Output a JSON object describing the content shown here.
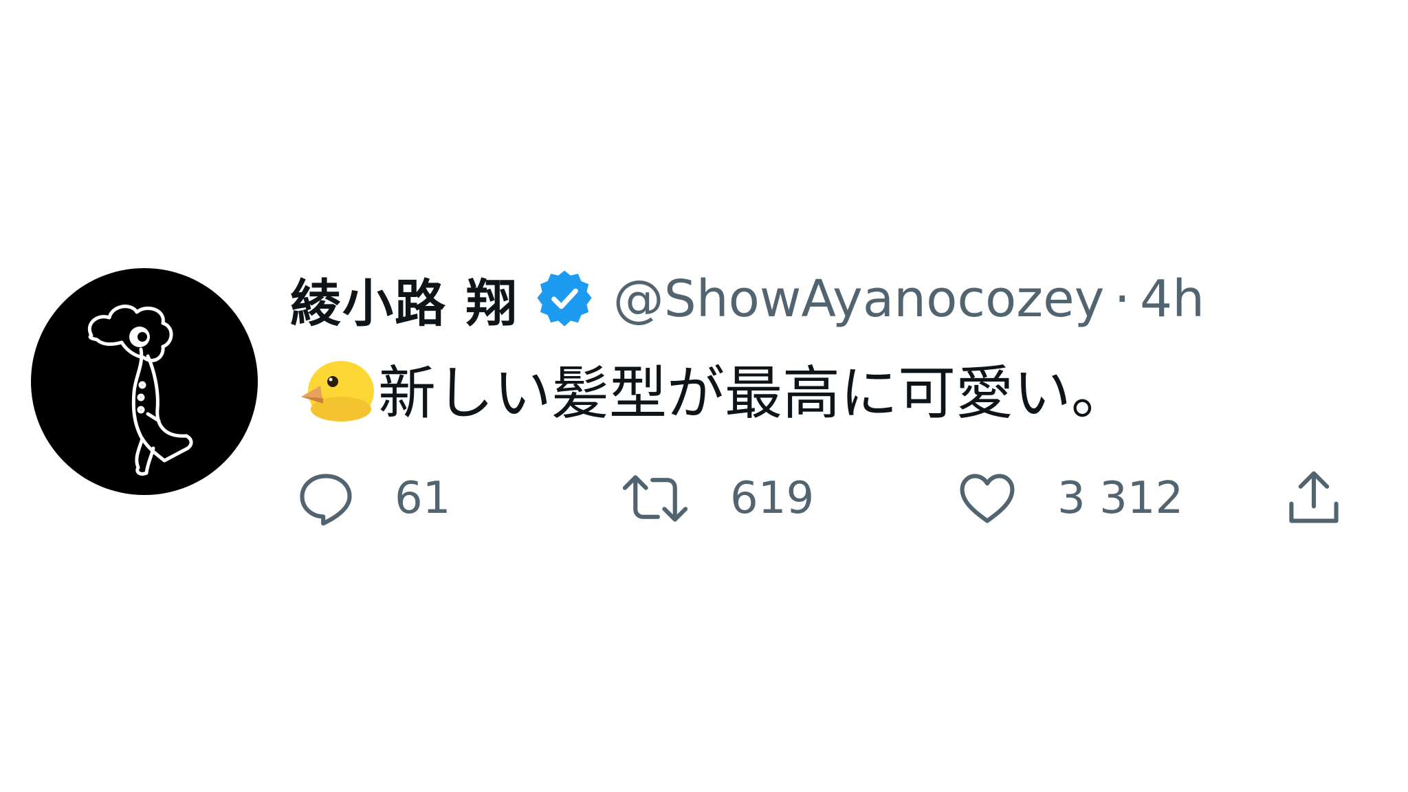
{
  "tweet": {
    "author": {
      "display_name": "綾小路 翔",
      "handle": "@ShowAyanocozey",
      "verified": true,
      "avatar_icon": "walking-figure-avatar"
    },
    "separator": "·",
    "time": "4h",
    "emoji_icon": "baby-chick-icon",
    "text": "新しい髪型が最高に可愛い。",
    "actions": {
      "reply": {
        "icon": "reply-icon",
        "count": "61"
      },
      "retweet": {
        "icon": "retweet-icon",
        "count": "619"
      },
      "like": {
        "icon": "heart-icon",
        "count": "3 312"
      },
      "share": {
        "icon": "share-icon"
      }
    }
  },
  "colors": {
    "text_primary": "#0f1419",
    "text_secondary": "#536471",
    "verified_blue": "#1d9bf0",
    "chick_yellow": "#fdd835",
    "chick_beak": "#e8a25c",
    "avatar_bg": "#000000"
  }
}
